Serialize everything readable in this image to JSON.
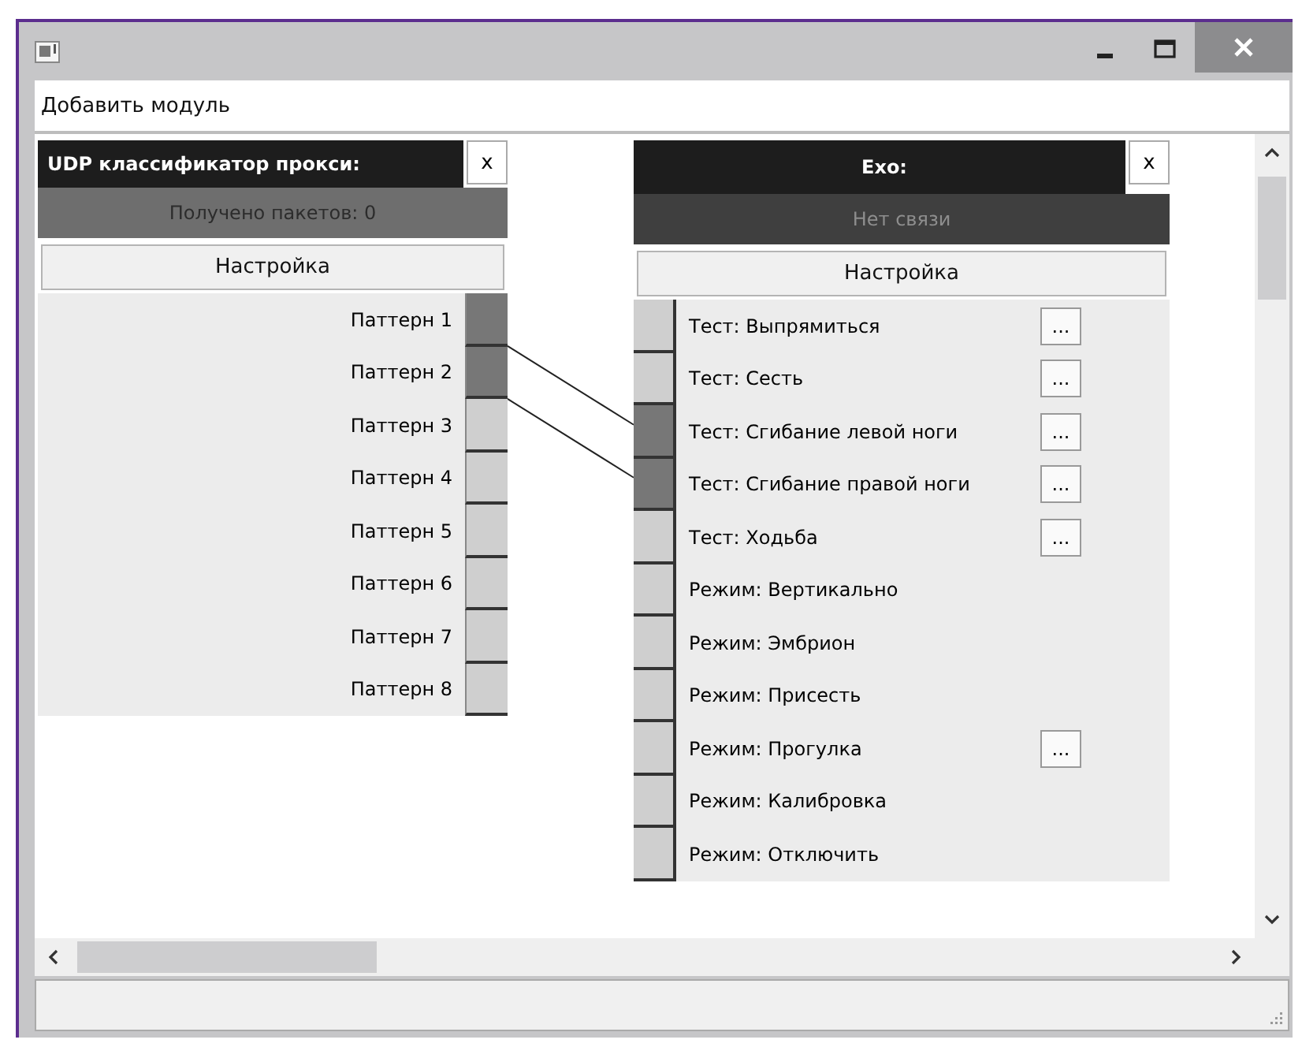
{
  "menu_bar": [
    {
      "label": "Добавить модуль"
    }
  ],
  "nodes": [
    {
      "kind": "source",
      "title": "UDP классификатор прокси:",
      "close": "x",
      "status": "Получено пакетов: 0",
      "online": true,
      "settings": "Настройка",
      "items": [
        {
          "label": "Паттерн 1",
          "linked": true
        },
        {
          "label": "Паттерн 2",
          "linked": true
        },
        {
          "label": "Паттерн 3",
          "linked": false
        },
        {
          "label": "Паттерн 4",
          "linked": false
        },
        {
          "label": "Паттерн 5",
          "linked": false
        },
        {
          "label": "Паттерн 6",
          "linked": false
        },
        {
          "label": "Паттерн 7",
          "linked": false
        },
        {
          "label": "Паттерн 8",
          "linked": false
        }
      ]
    },
    {
      "kind": "sink",
      "title": "Exo:",
      "close": "x",
      "status": "Нет связи",
      "online": false,
      "settings": "Настройка",
      "items": [
        {
          "label": "Тест: Выпрямиться",
          "linked": false,
          "options": "..."
        },
        {
          "label": "Тест: Сесть",
          "linked": false,
          "options": "..."
        },
        {
          "label": "Тест: Сгибание левой ноги",
          "linked": true,
          "options": "..."
        },
        {
          "label": "Тест: Сгибание правой ноги",
          "linked": true,
          "options": "..."
        },
        {
          "label": "Тест: Ходьба",
          "linked": false,
          "options": "..."
        },
        {
          "label": "Режим: Вертикально",
          "linked": false
        },
        {
          "label": "Режим: Эмбрион",
          "linked": false
        },
        {
          "label": "Режим: Присесть",
          "linked": false
        },
        {
          "label": "Режим: Прогулка",
          "linked": false,
          "options": "..."
        },
        {
          "label": "Режим: Калибровка",
          "linked": false
        },
        {
          "label": "Режим: Отключить",
          "linked": false
        }
      ]
    }
  ]
}
